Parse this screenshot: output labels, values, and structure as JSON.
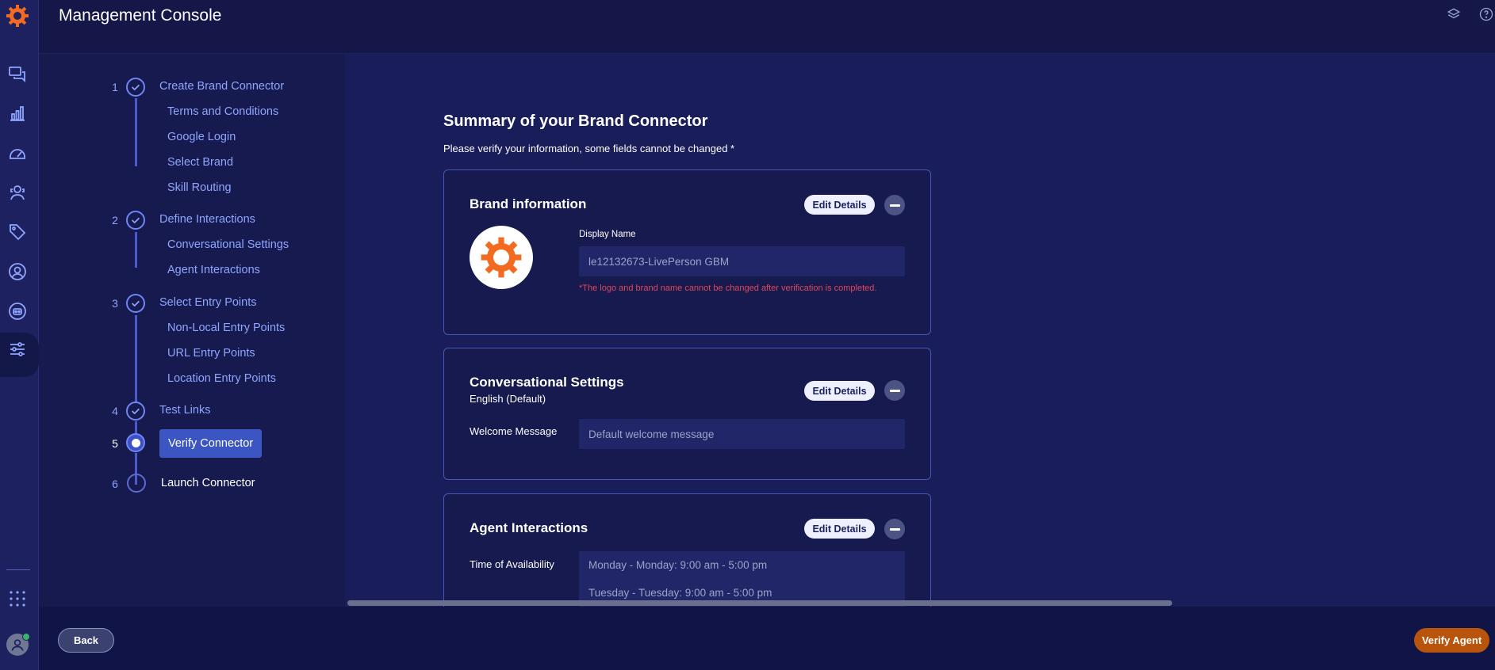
{
  "app": {
    "title": "Management Console"
  },
  "stepper": {
    "steps": [
      {
        "num": "1",
        "label": "Create Brand Connector",
        "state": "done",
        "subs": [
          "Terms and Conditions",
          "Google Login",
          "Select Brand",
          "Skill Routing"
        ]
      },
      {
        "num": "2",
        "label": "Define Interactions",
        "state": "done",
        "subs": [
          "Conversational Settings",
          "Agent Interactions"
        ]
      },
      {
        "num": "3",
        "label": "Select Entry Points",
        "state": "done",
        "subs": [
          "Non-Local Entry Points",
          "URL Entry Points",
          "Location Entry Points"
        ]
      },
      {
        "num": "4",
        "label": "Test Links",
        "state": "done",
        "subs": []
      },
      {
        "num": "5",
        "label": "Verify Connector",
        "state": "current",
        "subs": []
      },
      {
        "num": "6",
        "label": "Launch Connector",
        "state": "future",
        "subs": []
      }
    ]
  },
  "summary": {
    "title": "Summary of your Brand Connector",
    "subtitle": "Please verify your information, some fields cannot be changed *"
  },
  "cards": {
    "brand": {
      "title": "Brand information",
      "edit_label": "Edit Details",
      "display_name_label": "Display Name",
      "display_name_value": "le12132673-LivePerson GBM",
      "note": "*The logo and brand name cannot be changed after verification is completed."
    },
    "conversational": {
      "title": "Conversational Settings",
      "language": "English (Default)",
      "edit_label": "Edit Details",
      "welcome_label": "Welcome Message",
      "welcome_value": "Default welcome message"
    },
    "agent": {
      "title": "Agent Interactions",
      "edit_label": "Edit Details",
      "availability_label": "Time of Availability",
      "availability_rows": [
        "Monday - Monday: 9:00 am - 5:00 pm",
        "Tuesday - Tuesday: 9:00 am - 5:00 pm"
      ]
    }
  },
  "footer": {
    "back_label": "Back",
    "verify_label": "Verify Agent"
  },
  "colors": {
    "accent": "#3b56c2",
    "brand_orange": "#f26b21",
    "verify_button": "#b8540b",
    "error": "#e0475a"
  },
  "icons": {
    "rail": [
      "conversations-icon",
      "analytics-icon",
      "dashboard-icon",
      "agent-icon",
      "tag-icon",
      "user-icon",
      "bot-icon",
      "settings-sliders-icon",
      "apps-grid-icon"
    ],
    "header": [
      "layers-icon",
      "help-icon"
    ]
  }
}
